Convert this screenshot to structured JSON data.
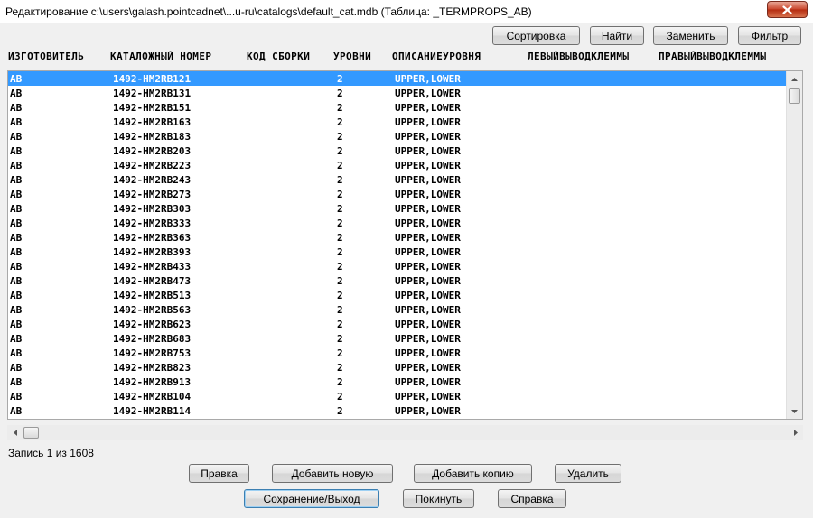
{
  "window": {
    "title": "Редактирование c:\\users\\galash.pointcadnet\\...u-ru\\catalogs\\default_cat.mdb (Таблица: _TERMPROPS_AB)",
    "close_icon": "close-icon"
  },
  "toolbar": {
    "sort_label": "Сортировка",
    "find_label": "Найти",
    "replace_label": "Заменить",
    "filter_label": "Фильтр"
  },
  "columns": [
    "ИЗГОТОВИТЕЛЬ",
    "КАТАЛОЖНЫЙ НОМЕР",
    "КОД СБОРКИ",
    "УРОВНИ",
    "ОПИСАНИЕУРОВНЯ",
    "ЛЕВЫЙВЫВОДКЛЕММЫ",
    "ПРАВЫЙВЫВОДКЛЕММЫ"
  ],
  "rows": [
    {
      "manufacturer": "AB",
      "catalog": "1492-HM2RB121",
      "assembly": "",
      "levels": "2",
      "level_desc": "UPPER,LOWER"
    },
    {
      "manufacturer": "AB",
      "catalog": "1492-HM2RB131",
      "assembly": "",
      "levels": "2",
      "level_desc": "UPPER,LOWER"
    },
    {
      "manufacturer": "AB",
      "catalog": "1492-HM2RB151",
      "assembly": "",
      "levels": "2",
      "level_desc": "UPPER,LOWER"
    },
    {
      "manufacturer": "AB",
      "catalog": "1492-HM2RB163",
      "assembly": "",
      "levels": "2",
      "level_desc": "UPPER,LOWER"
    },
    {
      "manufacturer": "AB",
      "catalog": "1492-HM2RB183",
      "assembly": "",
      "levels": "2",
      "level_desc": "UPPER,LOWER"
    },
    {
      "manufacturer": "AB",
      "catalog": "1492-HM2RB203",
      "assembly": "",
      "levels": "2",
      "level_desc": "UPPER,LOWER"
    },
    {
      "manufacturer": "AB",
      "catalog": "1492-HM2RB223",
      "assembly": "",
      "levels": "2",
      "level_desc": "UPPER,LOWER"
    },
    {
      "manufacturer": "AB",
      "catalog": "1492-HM2RB243",
      "assembly": "",
      "levels": "2",
      "level_desc": "UPPER,LOWER"
    },
    {
      "manufacturer": "AB",
      "catalog": "1492-HM2RB273",
      "assembly": "",
      "levels": "2",
      "level_desc": "UPPER,LOWER"
    },
    {
      "manufacturer": "AB",
      "catalog": "1492-HM2RB303",
      "assembly": "",
      "levels": "2",
      "level_desc": "UPPER,LOWER"
    },
    {
      "manufacturer": "AB",
      "catalog": "1492-HM2RB333",
      "assembly": "",
      "levels": "2",
      "level_desc": "UPPER,LOWER"
    },
    {
      "manufacturer": "AB",
      "catalog": "1492-HM2RB363",
      "assembly": "",
      "levels": "2",
      "level_desc": "UPPER,LOWER"
    },
    {
      "manufacturer": "AB",
      "catalog": "1492-HM2RB393",
      "assembly": "",
      "levels": "2",
      "level_desc": "UPPER,LOWER"
    },
    {
      "manufacturer": "AB",
      "catalog": "1492-HM2RB433",
      "assembly": "",
      "levels": "2",
      "level_desc": "UPPER,LOWER"
    },
    {
      "manufacturer": "AB",
      "catalog": "1492-HM2RB473",
      "assembly": "",
      "levels": "2",
      "level_desc": "UPPER,LOWER"
    },
    {
      "manufacturer": "AB",
      "catalog": "1492-HM2RB513",
      "assembly": "",
      "levels": "2",
      "level_desc": "UPPER,LOWER"
    },
    {
      "manufacturer": "AB",
      "catalog": "1492-HM2RB563",
      "assembly": "",
      "levels": "2",
      "level_desc": "UPPER,LOWER"
    },
    {
      "manufacturer": "AB",
      "catalog": "1492-HM2RB623",
      "assembly": "",
      "levels": "2",
      "level_desc": "UPPER,LOWER"
    },
    {
      "manufacturer": "AB",
      "catalog": "1492-HM2RB683",
      "assembly": "",
      "levels": "2",
      "level_desc": "UPPER,LOWER"
    },
    {
      "manufacturer": "AB",
      "catalog": "1492-HM2RB753",
      "assembly": "",
      "levels": "2",
      "level_desc": "UPPER,LOWER"
    },
    {
      "manufacturer": "AB",
      "catalog": "1492-HM2RB823",
      "assembly": "",
      "levels": "2",
      "level_desc": "UPPER,LOWER"
    },
    {
      "manufacturer": "AB",
      "catalog": "1492-HM2RB913",
      "assembly": "",
      "levels": "2",
      "level_desc": "UPPER,LOWER"
    },
    {
      "manufacturer": "AB",
      "catalog": "1492-HM2RB104",
      "assembly": "",
      "levels": "2",
      "level_desc": "UPPER,LOWER"
    },
    {
      "manufacturer": "AB",
      "catalog": "1492-HM2RB114",
      "assembly": "",
      "levels": "2",
      "level_desc": "UPPER,LOWER"
    }
  ],
  "selected_row": 0,
  "status": {
    "record_text": "Запись 1 из 1608"
  },
  "actions": {
    "edit_label": "Правка",
    "add_new_label": "Добавить новую",
    "add_copy_label": "Добавить копию",
    "delete_label": "Удалить",
    "save_exit_label": "Сохранение/Выход",
    "leave_label": "Покинуть",
    "help_label": "Справка"
  },
  "colors": {
    "selection": "#3399ff",
    "close_button": "#c9452b"
  }
}
